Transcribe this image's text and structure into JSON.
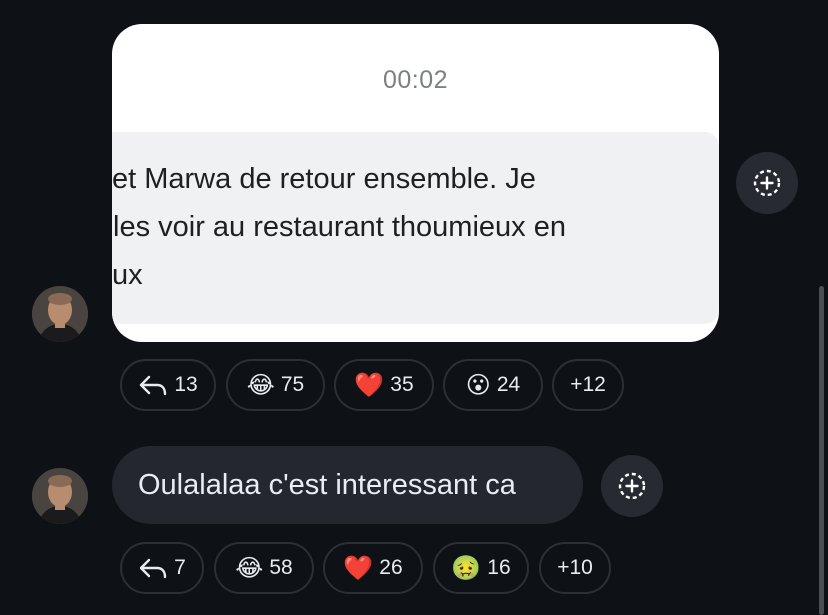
{
  "messages": [
    {
      "type": "video",
      "timecode": "00:02",
      "caption_lines": [
        "et Marwa de retour ensemble. Je",
        " les voir au restaurant thoumieux en",
        "ux"
      ],
      "reactions": [
        {
          "icon": "reply-icon",
          "count": "13"
        },
        {
          "icon": "tears-of-joy-emoji",
          "emoji": "😂",
          "count": "75"
        },
        {
          "icon": "red-heart-emoji",
          "emoji": "❤️",
          "count": "35"
        },
        {
          "icon": "hushed-face-emoji",
          "emoji": "😮",
          "count": "24"
        },
        {
          "icon": "",
          "count": "+12"
        }
      ]
    },
    {
      "type": "text",
      "text": "Oulalalaa c'est interessant ca",
      "reactions": [
        {
          "icon": "reply-icon",
          "count": "7"
        },
        {
          "icon": "tears-of-joy-emoji",
          "emoji": "😂",
          "count": "58"
        },
        {
          "icon": "red-heart-emoji",
          "emoji": "❤️",
          "count": "26"
        },
        {
          "icon": "nauseated-face-emoji",
          "emoji": "🤢",
          "count": "16"
        },
        {
          "icon": "",
          "count": "+10"
        }
      ]
    }
  ],
  "colors": {
    "background": "#0e1116",
    "bubble": "#24282e",
    "pill_border": "#2c3036",
    "add_button": "#272b31"
  }
}
